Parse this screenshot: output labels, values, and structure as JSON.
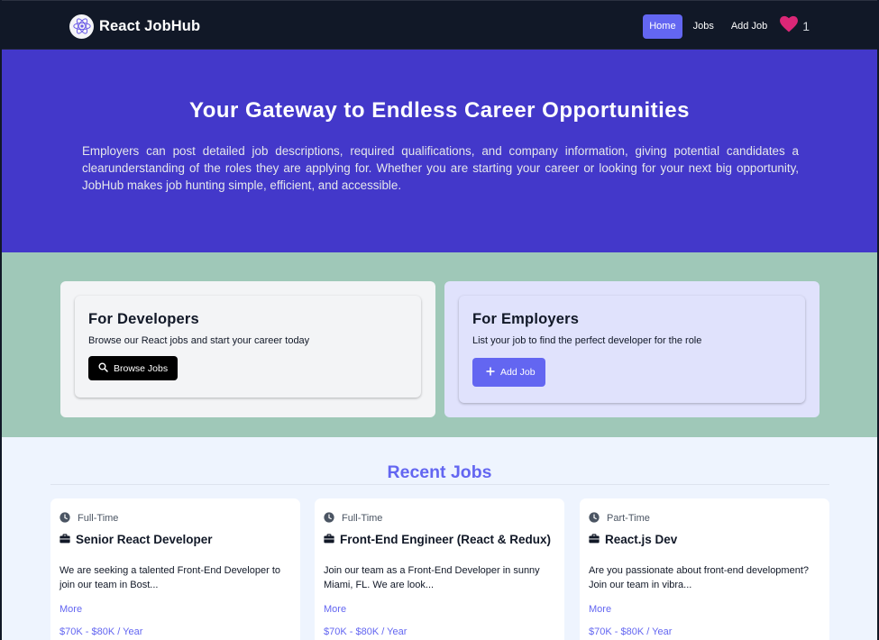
{
  "navbar": {
    "brand": "React JobHub",
    "links": [
      "Home",
      "Jobs",
      "Add Job"
    ],
    "favorites_count": "1"
  },
  "hero": {
    "title": "Your Gateway to Endless Career Opportunities",
    "text": "Employers can post detailed job descriptions, required qualifications, and company information, giving potential candidates a clearunderstanding of the roles they are applying for. Whether you are starting your career or looking for your next big opportunity, JobHub makes job hunting simple, efficient, and accessible."
  },
  "developers_card": {
    "title": "For Developers",
    "subtitle": "Browse our React jobs and start your career today",
    "button": "Browse Jobs"
  },
  "employers_card": {
    "title": "For Employers",
    "subtitle": "List your job to find the perfect developer for the role",
    "button": "Add Job"
  },
  "recent_jobs": {
    "title": "Recent Jobs",
    "jobs": [
      {
        "type": "Full-Time",
        "title": "Senior React Developer",
        "description": "We are seeking a talented Front-End Developer to join our team in Bost...",
        "more": "More",
        "salary": "$70K - $80K / Year"
      },
      {
        "type": "Full-Time",
        "title": "Front-End Engineer (React & Redux)",
        "description": "Join our team as a Front-End Developer in sunny Miami, FL. We are look...",
        "more": "More",
        "salary": "$70K - $80K / Year"
      },
      {
        "type": "Part-Time",
        "title": "React.js Dev",
        "description": "Are you passionate about front-end development? Join our team in vibra...",
        "more": "More",
        "salary": "$70K - $80K / Year"
      }
    ]
  },
  "colors": {
    "navbar_bg": "#111827",
    "hero_bg": "#4338ca",
    "accent": "#6366f1",
    "cards_section_bg": "#9fc8b8",
    "jobs_section_bg": "#eef4fe",
    "favorite_heart": "#db2777"
  }
}
